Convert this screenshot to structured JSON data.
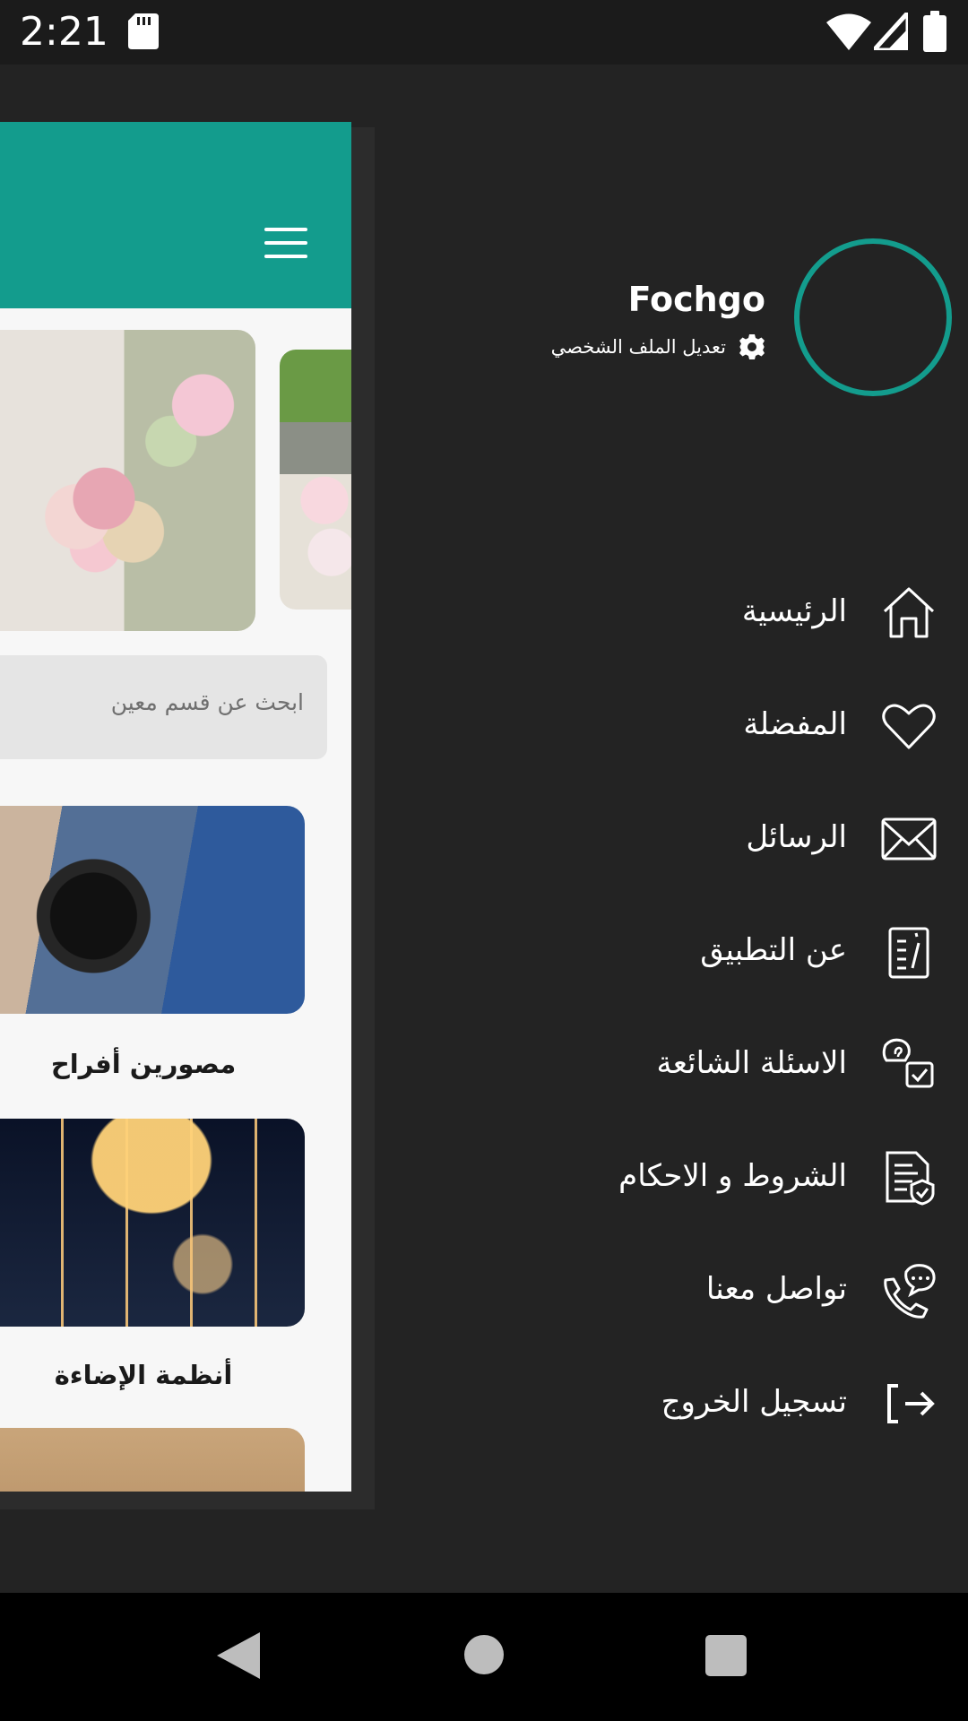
{
  "status_bar": {
    "time": "2:21",
    "icons": [
      "sd-card-icon",
      "wifi-icon",
      "signal-icon",
      "battery-icon"
    ]
  },
  "app_preview": {
    "header_color": "#139c8d",
    "search_placeholder": "ابحث عن قسم معين",
    "categories": [
      {
        "title": "مصورين أفراح"
      },
      {
        "title": "أنظمة الإضاءة"
      }
    ]
  },
  "profile": {
    "name": "Fochgo",
    "edit_profile_label": "تعديل الملف الشخصي",
    "avatar_ring_color": "#139c8d"
  },
  "menu": {
    "items": [
      {
        "label": "الرئيسية",
        "icon": "home-icon"
      },
      {
        "label": "المفضلة",
        "icon": "heart-icon"
      },
      {
        "label": "الرسائل",
        "icon": "envelope-icon"
      },
      {
        "label": "عن التطبيق",
        "icon": "document-info-icon"
      },
      {
        "label": "الاسئلة الشائعة",
        "icon": "faq-icon"
      },
      {
        "label": "الشروط و الاحكام",
        "icon": "terms-document-icon"
      },
      {
        "label": "تواصل معنا",
        "icon": "phone-chat-icon"
      },
      {
        "label": "تسجيل الخروج",
        "icon": "logout-icon"
      }
    ]
  },
  "navigation": {
    "icons": [
      "back-icon",
      "home-circle-icon",
      "recents-square-icon"
    ]
  },
  "colors": {
    "drawer_background": "#232323",
    "accent": "#139c8d",
    "text": "#ffffff"
  }
}
